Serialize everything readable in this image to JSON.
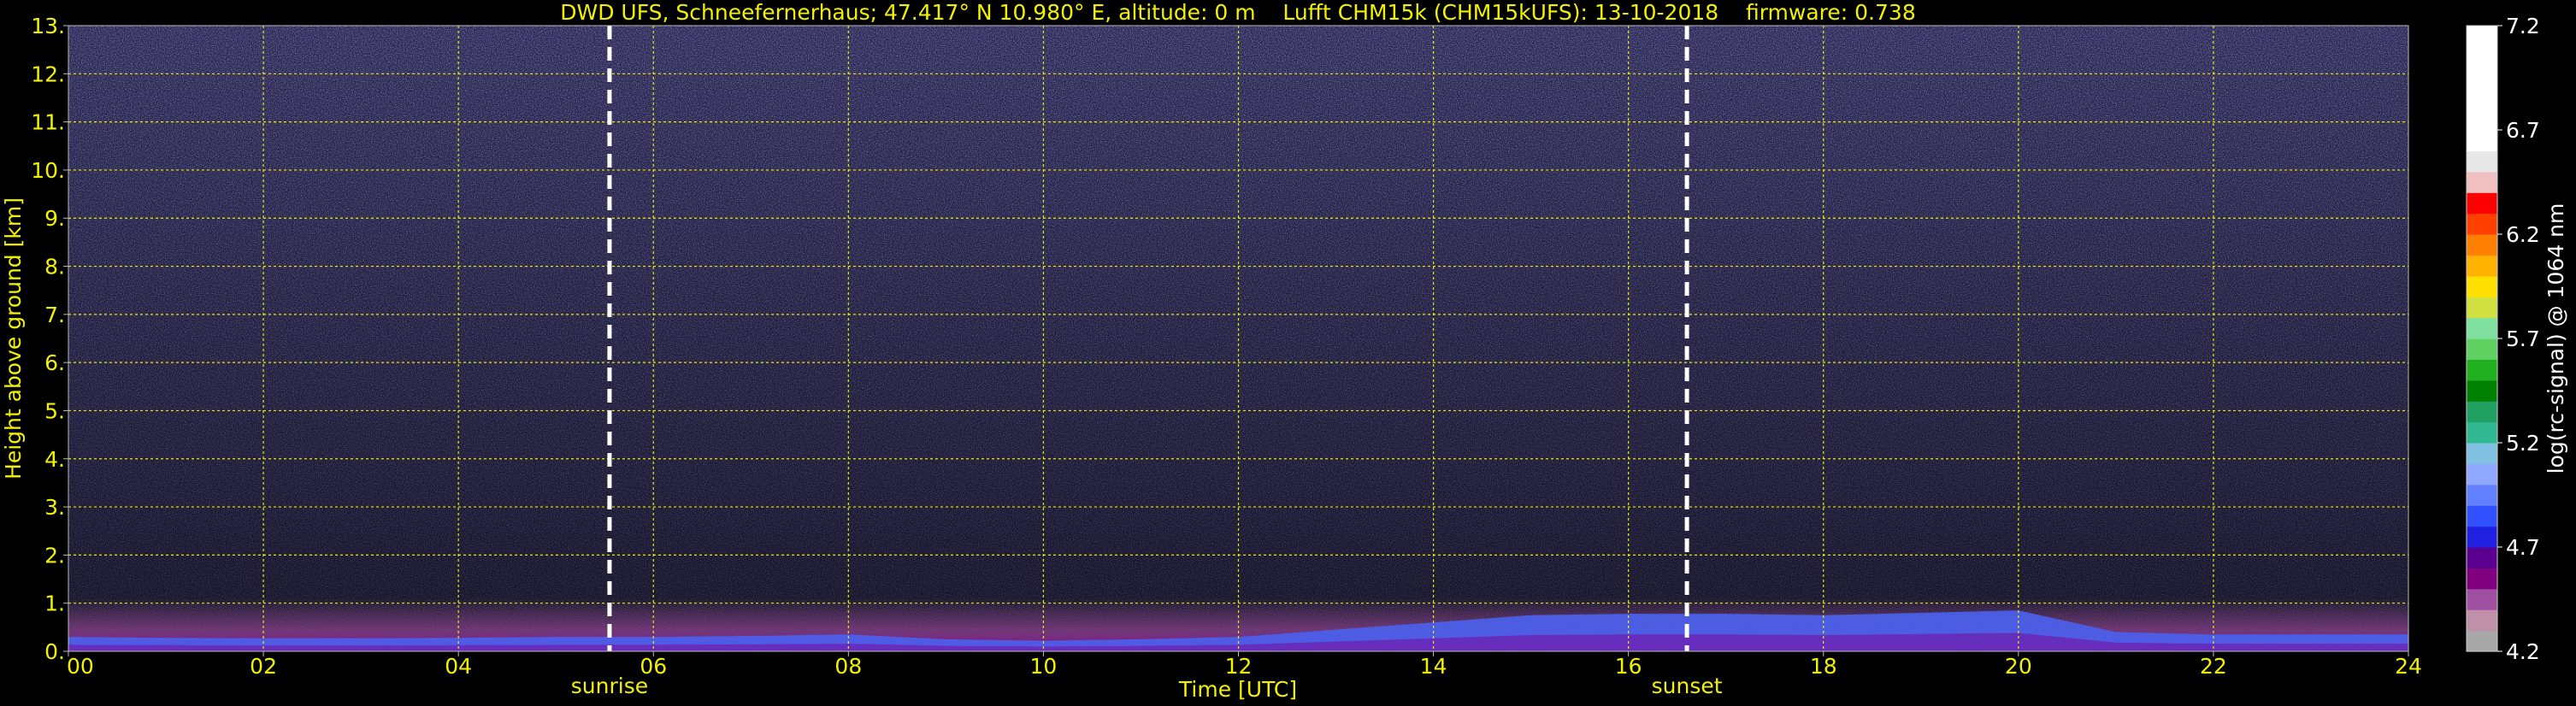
{
  "title": "DWD UFS, Schneefernerhaus; 47.417° N 10.980° E, altitude: 0 m    Lufft CHM15k (CHM15kUFS): 13-10-2018    firmware: 0.738",
  "chart_data": {
    "type": "heatmap",
    "xlabel": "Time [UTC]",
    "ylabel": "Height above ground [km]",
    "xlim": [
      0,
      24
    ],
    "ylim": [
      0,
      13
    ],
    "x_ticks": [
      "00",
      "02",
      "04",
      "06",
      "08",
      "10",
      "12",
      "14",
      "16",
      "18",
      "20",
      "22",
      "24"
    ],
    "x_tick_values": [
      0,
      2,
      4,
      6,
      8,
      10,
      12,
      14,
      16,
      18,
      20,
      22,
      24
    ],
    "y_ticks": [
      "0.",
      "1.",
      "2.",
      "3.",
      "4.",
      "5.",
      "6.",
      "7.",
      "8.",
      "9.",
      "10.",
      "11.",
      "12.",
      "13."
    ],
    "y_tick_values": [
      0,
      1,
      2,
      3,
      4,
      5,
      6,
      7,
      8,
      9,
      10,
      11,
      12,
      13
    ],
    "grid": true,
    "grid_color": "#ffff00",
    "events": [
      {
        "label": "sunrise",
        "time": 5.55
      },
      {
        "label": "sunset",
        "time": 16.6
      }
    ],
    "colorbar": {
      "label": "log(rc-signal) @ 1064 nm",
      "range": [
        4.2,
        7.2
      ],
      "tick_labels": [
        "4.2",
        "4.7",
        "5.2",
        "5.7",
        "6.2",
        "6.7",
        "7.2"
      ],
      "tick_values": [
        4.2,
        4.7,
        5.2,
        5.7,
        6.2,
        6.7,
        7.2
      ],
      "colors": [
        "#a8a8a8",
        "#c090a8",
        "#a050a0",
        "#800080",
        "#5a0090",
        "#2020e0",
        "#3050ff",
        "#6080ff",
        "#90a8ff",
        "#80c0e0",
        "#30b890",
        "#20a060",
        "#008000",
        "#20b020",
        "#60d060",
        "#80e0a0",
        "#d0e040",
        "#ffe000",
        "#ffb000",
        "#ff8000",
        "#ff4000",
        "#ff0000",
        "#f0c0c0",
        "#e8e8e8",
        "#ffffff",
        "#ffffff",
        "#ffffff",
        "#ffffff",
        "#ffffff",
        "#ffffff"
      ]
    },
    "boundary_layer_top_km": [
      [
        0,
        0.3
      ],
      [
        1,
        0.28
      ],
      [
        2,
        0.27
      ],
      [
        3,
        0.27
      ],
      [
        4,
        0.28
      ],
      [
        5,
        0.3
      ],
      [
        6,
        0.3
      ],
      [
        7,
        0.32
      ],
      [
        8,
        0.35
      ],
      [
        9,
        0.25
      ],
      [
        10,
        0.22
      ],
      [
        11,
        0.25
      ],
      [
        12,
        0.3
      ],
      [
        13,
        0.45
      ],
      [
        14,
        0.6
      ],
      [
        15,
        0.75
      ],
      [
        16,
        0.78
      ],
      [
        17,
        0.78
      ],
      [
        18,
        0.75
      ],
      [
        19,
        0.8
      ],
      [
        20,
        0.85
      ],
      [
        21,
        0.4
      ],
      [
        22,
        0.35
      ],
      [
        23,
        0.35
      ],
      [
        24,
        0.35
      ]
    ],
    "aerosol_layer_top_km": 1.0
  }
}
